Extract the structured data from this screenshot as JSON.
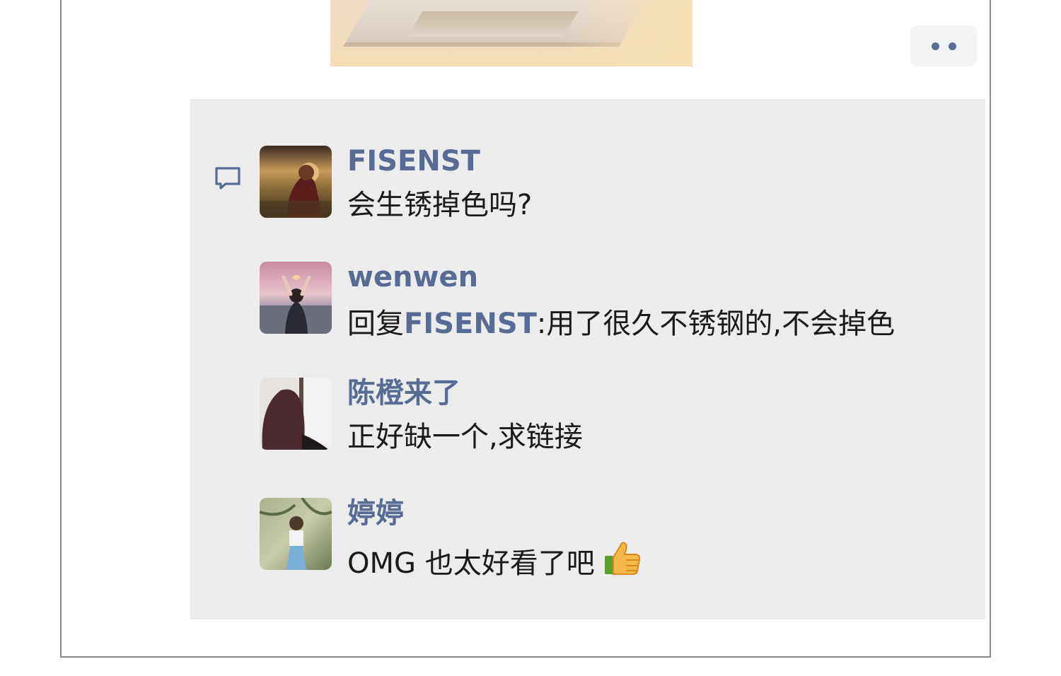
{
  "post": {
    "more_button_label": "",
    "colors": {
      "link": "#576b95",
      "comment_bg": "#ececec",
      "text": "#1a1a1a"
    }
  },
  "comments": [
    {
      "author": "FISENST",
      "text": "会生锈掉色吗?"
    },
    {
      "author": "wenwen",
      "reply_prefix": "回复",
      "reply_to": "FISENST",
      "text": ":用了很久不锈钢的,不会掉色"
    },
    {
      "author": "陈橙来了",
      "text": "正好缺一个,求链接"
    },
    {
      "author": "婷婷",
      "text": "OMG 也太好看了吧",
      "emoji": "thumbs-up-icon"
    }
  ],
  "icons": {
    "comments_section": "comment-bubble-icon",
    "more": "more-dots-icon"
  }
}
